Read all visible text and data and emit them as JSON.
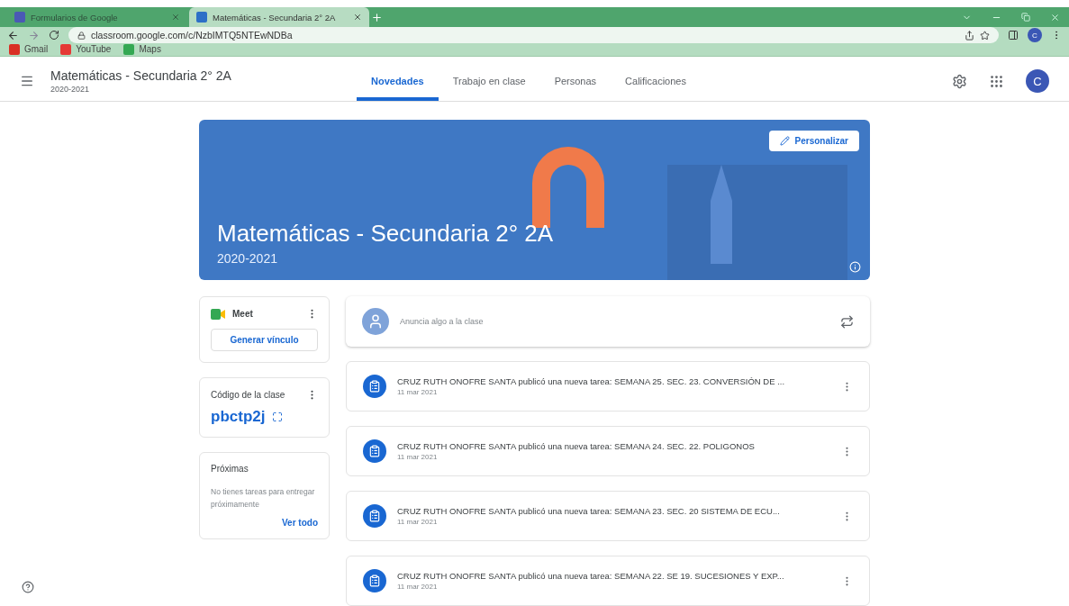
{
  "browser": {
    "tabs": [
      {
        "title": "Formularios de Google",
        "selected": false
      },
      {
        "title": "Matemáticas - Secundaria 2° 2A",
        "selected": true
      }
    ],
    "url": "classroom.google.com/c/NzbIMTQ5NTEwNDBa",
    "profile_initial": "C",
    "bookmarks": [
      "Gmail",
      "YouTube",
      "Maps"
    ]
  },
  "header": {
    "class_name": "Matemáticas - Secundaria 2° 2A",
    "year": "2020-2021",
    "avatar_initial": "C",
    "tabs": [
      {
        "label": "Novedades",
        "selected": true
      },
      {
        "label": "Trabajo en clase",
        "selected": false
      },
      {
        "label": "Personas",
        "selected": false
      },
      {
        "label": "Calificaciones",
        "selected": false
      }
    ]
  },
  "banner": {
    "title": "Matemáticas - Secundaria 2° 2A",
    "subtitle": "2020-2021",
    "customize_button": "Personalizar"
  },
  "meet": {
    "title": "Meet",
    "button": "Generar vínculo"
  },
  "class_code": {
    "title": "Código de la clase",
    "code": "pbctp2j"
  },
  "upcoming": {
    "title": "Próximas",
    "message": "No tienes tareas para entregar próximamente",
    "link": "Ver todo"
  },
  "announce": {
    "placeholder": "Anuncia algo a la clase"
  },
  "posts": [
    {
      "text": "CRUZ RUTH ONOFRE SANTA publicó una nueva tarea: SEMANA 25. SEC. 23. CONVERSIÓN DE ...",
      "date": "11 mar 2021"
    },
    {
      "text": "CRUZ RUTH ONOFRE SANTA publicó una nueva tarea: SEMANA 24. SEC. 22. POLIGONOS",
      "date": "11 mar 2021"
    },
    {
      "text": "CRUZ RUTH ONOFRE SANTA publicó una nueva tarea: SEMANA 23. SEC. 20 SISTEMA DE ECU...",
      "date": "11 mar 2021"
    },
    {
      "text": "CRUZ RUTH ONOFRE SANTA publicó una nueva tarea: SEMANA 22. SE 19. SUCESIONES Y EXP...",
      "date": "11 mar 2021"
    }
  ]
}
